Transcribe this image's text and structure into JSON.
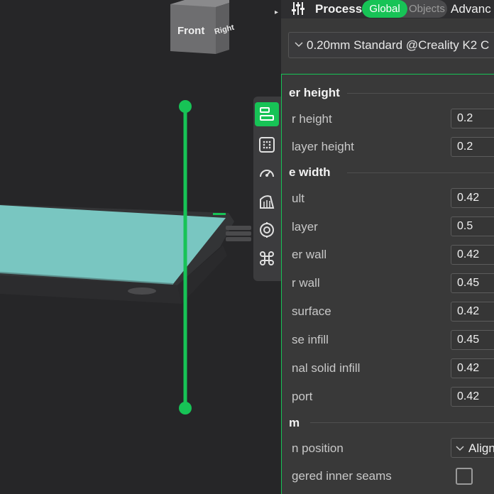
{
  "view_cube": {
    "front_label": "Front",
    "right_label": "Right"
  },
  "toolbar": {
    "icons": [
      "layer-height-icon",
      "plate-grid-icon",
      "speed-gauge-icon",
      "support-icon",
      "target-icon",
      "command-icon"
    ],
    "active_index": 0
  },
  "panel": {
    "title": "Process",
    "mode_global": "Global",
    "mode_objects": "Objects",
    "advanced": "Advanc",
    "preset": "0.20mm Standard @Creality K2 C"
  },
  "sections": {
    "layer_height": "er height",
    "line_width": "e width",
    "seam": "m"
  },
  "settings": {
    "layer_height": {
      "label": "r height",
      "value": "0.2"
    },
    "first_layer_height": {
      "label": "layer height",
      "value": "0.2"
    },
    "default": {
      "label": "ult",
      "value": "0.42"
    },
    "first_layer": {
      "label": "layer",
      "value": "0.5"
    },
    "outer_wall": {
      "label": "er wall",
      "value": "0.42"
    },
    "inner_wall": {
      "label": "r wall",
      "value": "0.45"
    },
    "top_surface": {
      "label": "surface",
      "value": "0.42"
    },
    "sparse_infill": {
      "label": "se infill",
      "value": "0.45"
    },
    "internal_solid": {
      "label": "nal solid infill",
      "value": "0.42"
    },
    "support": {
      "label": "port",
      "value": "0.42"
    },
    "seam_position": {
      "label": "n position",
      "value": "Align"
    },
    "staggered_seams": {
      "label": "gered inner seams",
      "checked": false
    }
  },
  "colors": {
    "accent": "#17c356",
    "bed": "#79c6c1",
    "panel_bg": "#393939",
    "viewport_bg": "#262628"
  }
}
